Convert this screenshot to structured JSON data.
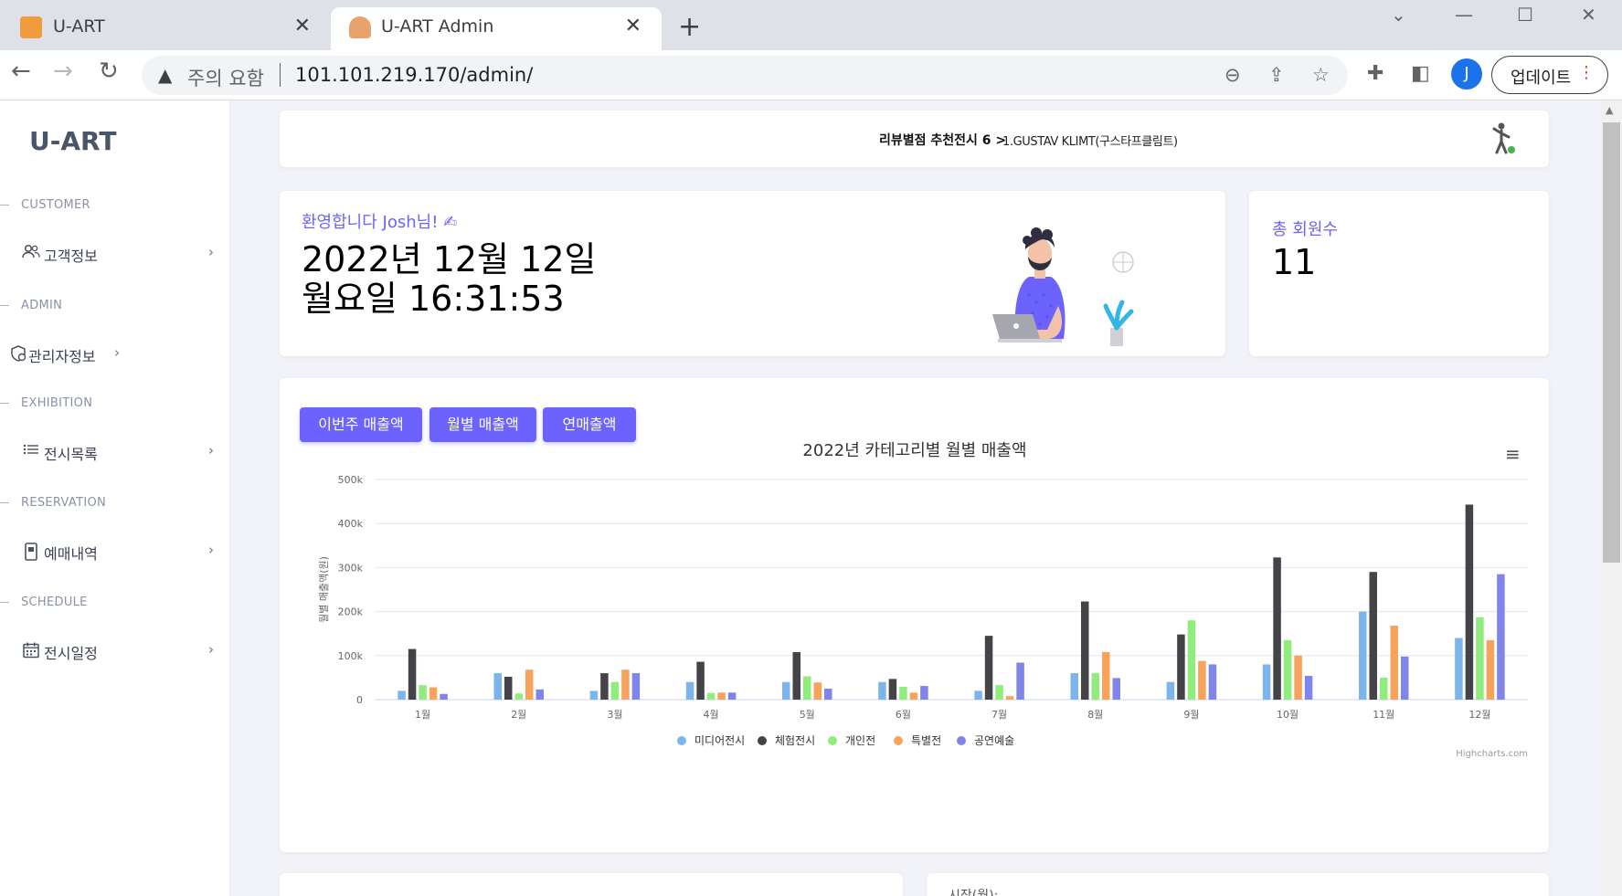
{
  "browser": {
    "tabs": [
      {
        "title": "U-ART",
        "active": false
      },
      {
        "title": "U-ART Admin",
        "active": true
      }
    ],
    "address": {
      "warning": "주의 요함",
      "url": "101.101.219.170/admin/"
    },
    "profile_initial": "J",
    "update_label": "업데이트"
  },
  "sidebar": {
    "brand": "U-ART",
    "sections": [
      {
        "title": "CUSTOMER",
        "item": "고객정보",
        "icon": "users-icon"
      },
      {
        "title": "ADMIN",
        "item": "관리자정보",
        "icon": "admin-shield-icon"
      },
      {
        "title": "EXHIBITION",
        "item": "전시목록",
        "icon": "list-icon"
      },
      {
        "title": "RESERVATION",
        "item": "예매내역",
        "icon": "ticket-icon"
      },
      {
        "title": "SCHEDULE",
        "item": "전시일정",
        "icon": "calendar-icon"
      }
    ]
  },
  "ticker": {
    "label": "리뷰별점 추천전시 6 >",
    "text": "1.GUSTAV KLIMT(구스타프클림트)"
  },
  "welcome": {
    "greeting": "환영합니다 Josh님! ✍",
    "date_line1": "2022년 12월 12일",
    "date_line2": "월요일 16:31:53"
  },
  "members": {
    "label": "총 회원수",
    "value": "11"
  },
  "chart_buttons": [
    "이번주 매출액",
    "월별 매출액",
    "연매출액"
  ],
  "bottom_right_text": "시작(월):",
  "chart_data": {
    "type": "bar",
    "title": "2022년 카테고리별 월별 매출액",
    "ylabel": "월별 매출액(원)",
    "xlabel": "",
    "ylim": [
      0,
      500000
    ],
    "yticks": [
      "0",
      "100k",
      "200k",
      "300k",
      "400k",
      "500k"
    ],
    "categories": [
      "1월",
      "2월",
      "3월",
      "4월",
      "5월",
      "6월",
      "7월",
      "8월",
      "9월",
      "10월",
      "11월",
      "12월"
    ],
    "legend_position": "bottom-center",
    "credit": "Highcharts.com",
    "series": [
      {
        "name": "미디어전시",
        "color": "#7cb5ec",
        "values": [
          20000,
          60000,
          20000,
          40000,
          40000,
          40000,
          20000,
          60000,
          40000,
          80000,
          200000,
          140000
        ]
      },
      {
        "name": "체험전시",
        "color": "#434348",
        "values": [
          115000,
          52000,
          60000,
          86000,
          108000,
          47000,
          145000,
          223000,
          148000,
          323000,
          290000,
          443000
        ]
      },
      {
        "name": "개인전",
        "color": "#90ed7d",
        "values": [
          33000,
          14000,
          40000,
          15000,
          53000,
          29000,
          33000,
          60000,
          180000,
          135000,
          50000,
          187000
        ]
      },
      {
        "name": "특별전",
        "color": "#f7a35c",
        "values": [
          28000,
          68000,
          68000,
          16000,
          39000,
          16000,
          8000,
          108000,
          88000,
          100000,
          168000,
          135000
        ]
      },
      {
        "name": "공연예술",
        "color": "#8085e9",
        "values": [
          13000,
          23000,
          60000,
          16000,
          25000,
          31000,
          84000,
          49000,
          80000,
          54000,
          98000,
          285000
        ]
      }
    ]
  }
}
